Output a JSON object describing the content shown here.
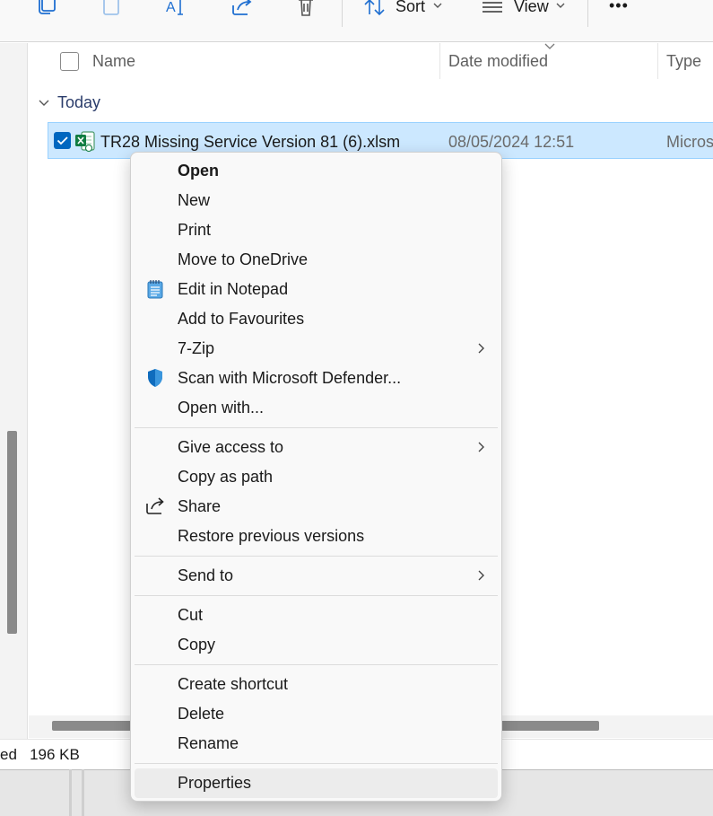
{
  "toolbar": {
    "sort_label": "Sort",
    "view_label": "View",
    "more_label": "•••"
  },
  "columns": {
    "name": "Name",
    "date_modified": "Date modified",
    "type": "Type"
  },
  "group": {
    "label": "Today"
  },
  "file": {
    "name": "TR28 Missing Service Version 81 (6).xlsm",
    "date_modified": "08/05/2024 12:51",
    "type": "Micros",
    "selected": true
  },
  "status_bar": {
    "text": "ed   196 KB"
  },
  "context_menu": {
    "items": [
      {
        "label": "Open"
      },
      {
        "label": "New"
      },
      {
        "label": "Print"
      },
      {
        "label": "Move to OneDrive"
      },
      {
        "label": "Edit in Notepad",
        "icon": "notepad-icon"
      },
      {
        "label": "Add to Favourites"
      },
      {
        "label": "7-Zip",
        "submenu": true
      },
      {
        "label": "Scan with Microsoft Defender...",
        "icon": "defender-shield-icon"
      },
      {
        "label": "Open with..."
      },
      {
        "label": "Give access to",
        "submenu": true
      },
      {
        "label": "Copy as path"
      },
      {
        "label": "Share",
        "icon": "share-icon"
      },
      {
        "label": "Restore previous versions"
      },
      {
        "label": "Send to",
        "submenu": true
      },
      {
        "label": "Cut"
      },
      {
        "label": "Copy"
      },
      {
        "label": "Create shortcut"
      },
      {
        "label": "Delete"
      },
      {
        "label": "Rename"
      },
      {
        "label": "Properties",
        "hovered": true
      }
    ]
  },
  "colors": {
    "selection_bg": "#cce8ff",
    "accent": "#0067c0",
    "excel_green": "#107c41",
    "defender_blue": "#0f6cbd"
  }
}
